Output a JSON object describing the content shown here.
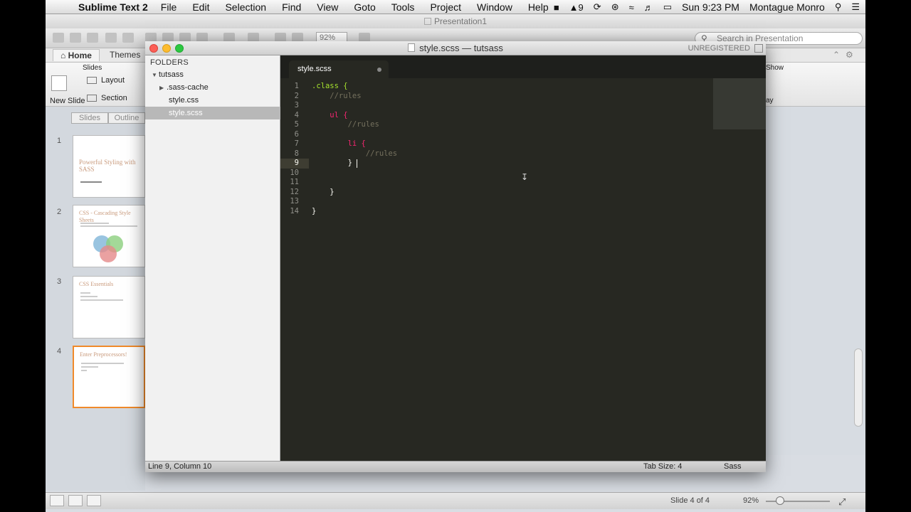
{
  "menubar": {
    "app_name": "Sublime Text 2",
    "items": [
      "File",
      "Edit",
      "Selection",
      "Find",
      "View",
      "Goto",
      "Tools",
      "Project",
      "Window",
      "Help"
    ],
    "status_count": "9",
    "clock": "Sun 9:23 PM",
    "user": "Montague Monro"
  },
  "ppt": {
    "window_title": "Presentation1",
    "zoom": "92%",
    "search_placeholder": "Search in Presentation",
    "tabs": [
      "Home",
      "Themes"
    ],
    "ribbon": {
      "group_slides": "Slides",
      "new_slide": "New Slide",
      "layout": "Layout",
      "section": "Section",
      "show": "Show",
      "ay": "ay"
    },
    "view_tabs": [
      "Slides",
      "Outline"
    ],
    "slides": [
      {
        "num": "1",
        "title": "Powerful Styling with SASS"
      },
      {
        "num": "2",
        "title": "CSS - Cascading Style Sheets"
      },
      {
        "num": "3",
        "title": "CSS Essentials"
      },
      {
        "num": "4",
        "title": "Enter Preprocessors!"
      }
    ],
    "status": {
      "slide_of": "Slide 4 of 4",
      "zoom": "92%"
    }
  },
  "sublime": {
    "title": "style.scss — tutsass",
    "unregistered": "UNREGISTERED",
    "folders_header": "FOLDERS",
    "tree": {
      "root": "tutsass",
      "items": [
        ".sass-cache",
        "style.css",
        "style.scss"
      ]
    },
    "tab_label": "style.scss",
    "code_lines": [
      {
        "n": "1",
        "text": ".class {"
      },
      {
        "n": "2",
        "text": "    //rules"
      },
      {
        "n": "3",
        "text": ""
      },
      {
        "n": "4",
        "text": "    ul {"
      },
      {
        "n": "5",
        "text": "        //rules"
      },
      {
        "n": "6",
        "text": ""
      },
      {
        "n": "7",
        "text": "        li {"
      },
      {
        "n": "8",
        "text": "            //rules"
      },
      {
        "n": "9",
        "text": "        }"
      },
      {
        "n": "10",
        "text": ""
      },
      {
        "n": "11",
        "text": ""
      },
      {
        "n": "12",
        "text": "    }"
      },
      {
        "n": "13",
        "text": ""
      },
      {
        "n": "14",
        "text": "}"
      }
    ],
    "status": {
      "position": "Line 9, Column 10",
      "tab_size": "Tab Size: 4",
      "syntax": "Sass"
    },
    "colors": {
      "background": "#272822",
      "selector": "#a6e22e",
      "tag": "#f92672",
      "comment": "#75715e"
    }
  }
}
